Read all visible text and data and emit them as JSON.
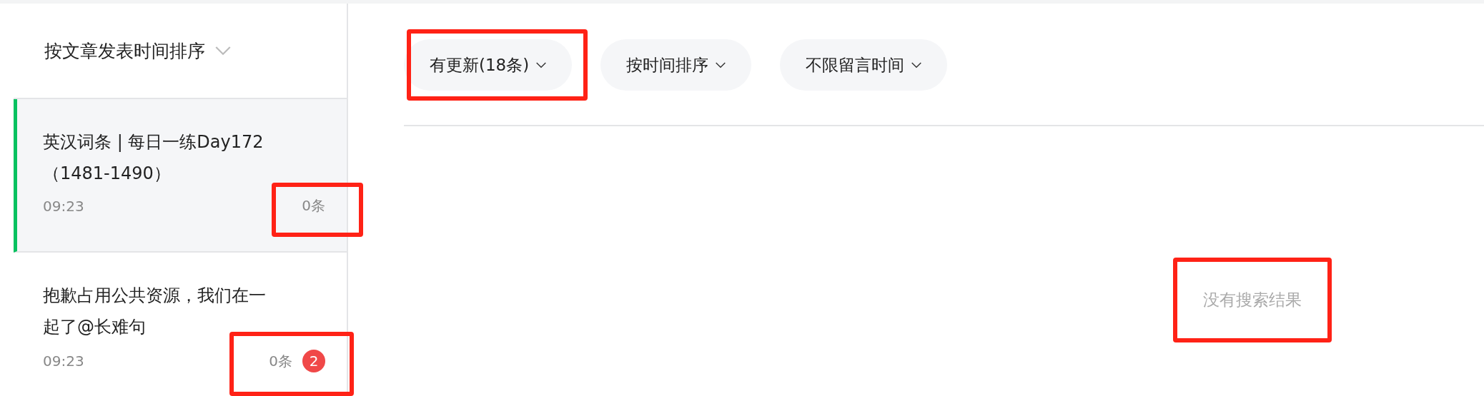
{
  "sidebar": {
    "sort_label": "按文章发表时间排序",
    "articles": [
      {
        "title": "英汉词条 | 每日一练Day172（1481-1490）",
        "time": "09:23",
        "count": "0条",
        "selected": true,
        "highlighted": true
      },
      {
        "title": "抱歉占用公共资源，我们在一起了@长难句",
        "time": "09:23",
        "count": "0条",
        "badge": "2",
        "selected": false,
        "highlighted": true
      }
    ]
  },
  "filters": [
    {
      "label": "有更新(18条)",
      "highlighted": true
    },
    {
      "label": "按时间排序",
      "highlighted": false
    },
    {
      "label": "不限留言时间",
      "highlighted": false
    }
  ],
  "empty_message": {
    "text": "没有搜索结果",
    "highlighted": true
  }
}
